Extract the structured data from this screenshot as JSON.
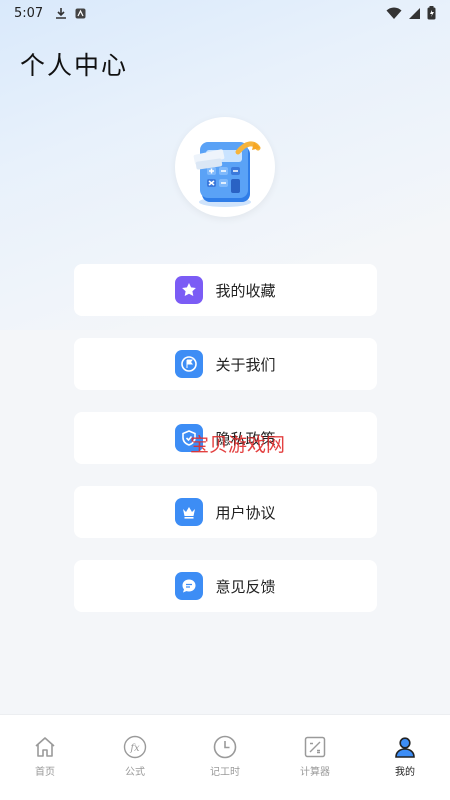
{
  "statusbar": {
    "time": "5:07"
  },
  "page": {
    "title": "个人中心"
  },
  "menu": [
    {
      "label": "我的收藏",
      "icon": "star-icon",
      "color": "#7b5cf5"
    },
    {
      "label": "关于我们",
      "icon": "flag-icon",
      "color": "#3d8df5"
    },
    {
      "label": "隐私政策",
      "icon": "shield-icon",
      "color": "#3d8df5"
    },
    {
      "label": "用户协议",
      "icon": "crown-icon",
      "color": "#3d8df5"
    },
    {
      "label": "意见反馈",
      "icon": "chat-icon",
      "color": "#3d8df5"
    }
  ],
  "watermark": "宝贝游戏网",
  "tabs": [
    {
      "label": "首页",
      "icon": "home-icon",
      "active": false
    },
    {
      "label": "公式",
      "icon": "formula-icon",
      "active": false
    },
    {
      "label": "记工时",
      "icon": "clock-icon",
      "active": false
    },
    {
      "label": "计算器",
      "icon": "calculator-icon",
      "active": false
    },
    {
      "label": "我的",
      "icon": "user-icon",
      "active": true
    }
  ],
  "colors": {
    "accent": "#3d8df5",
    "favorite": "#7b5cf5"
  }
}
